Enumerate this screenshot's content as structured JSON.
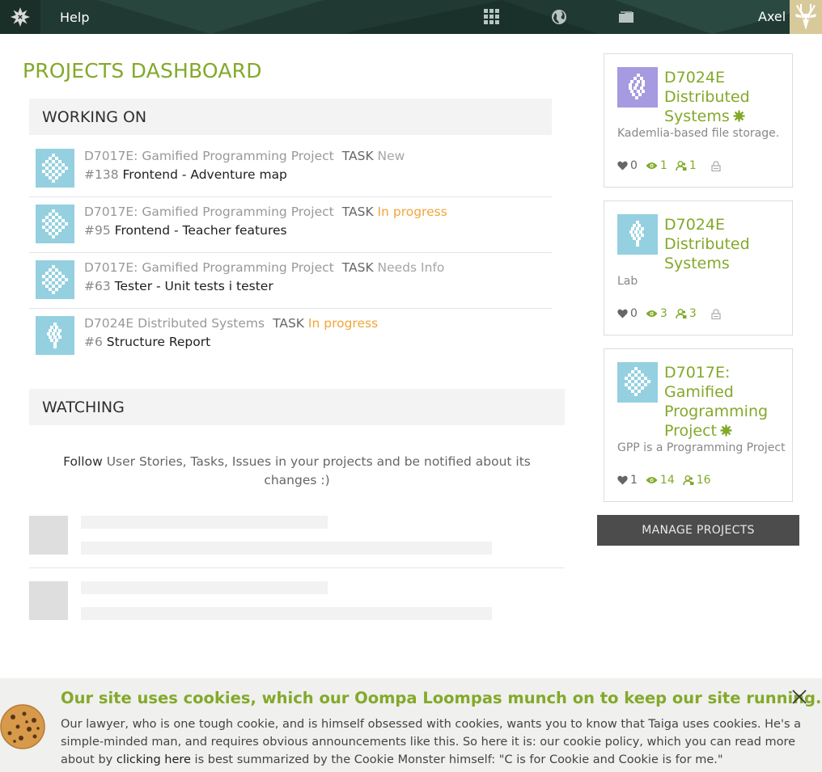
{
  "navbar": {
    "help_label": "Help",
    "user_name": "Axel",
    "icons": [
      "logo-icon",
      "projects-grid-icon",
      "discover-globe-icon",
      "inbox-folder-icon",
      "avatar-deer-icon"
    ]
  },
  "dashboard": {
    "title": "PROJECTS DASHBOARD",
    "working_on_title": "WORKING ON",
    "watching_title": "WATCHING",
    "working_items": [
      {
        "project": "D7017E: Gamified Programming Project",
        "type": "TASK",
        "status": "New",
        "ref": "#138",
        "subject": "Frontend - Adventure map"
      },
      {
        "project": "D7017E: Gamified Programming Project",
        "type": "TASK",
        "status": "In progress",
        "ref": "#95",
        "subject": "Frontend - Teacher features"
      },
      {
        "project": "D7017E: Gamified Programming Project",
        "type": "TASK",
        "status": "Needs Info",
        "ref": "#63",
        "subject": "Tester - Unit tests i tester"
      },
      {
        "project": "D7024E Distributed Systems",
        "type": "TASK",
        "status": "In progress",
        "ref": "#6",
        "subject": "Structure Report"
      }
    ],
    "follow_bold": "Follow",
    "follow_rest": "User Stories, Tasks, Issues in your projects and be notified about its changes :)"
  },
  "projects": [
    {
      "name": "D7024E Distributed Systems",
      "description": "Kademlia-based file storage.",
      "likes": "0",
      "watchers": "1",
      "members": "1",
      "looking_for_people": true,
      "private": true
    },
    {
      "name": "D7024E Distributed Systems",
      "description": "Lab",
      "likes": "0",
      "watchers": "3",
      "members": "3",
      "looking_for_people": false,
      "private": true
    },
    {
      "name": "D7017E: Gamified Programming Project",
      "description": "GPP is a Programming Project",
      "likes": "1",
      "watchers": "14",
      "members": "16",
      "looking_for_people": true,
      "private": false
    }
  ],
  "manage_projects_label": "MANAGE PROJECTS",
  "cookie": {
    "title": "Our site uses cookies, which our Oompa Loompas munch on to keep our site running.",
    "body_before": "Our lawyer, who is one tough cookie, and is himself obsessed with cookies, wants you to know that Taiga uses cookies. He's a simple-minded man, and requires obvious announcements like this. So here it is: our cookie policy, which you can read more about by ",
    "link_label": "clicking here",
    "body_after": " is best summarized by the Cookie Monster himself: \"C is for Cookie and Cookie is for me.\""
  },
  "colors": {
    "navbar": "#203a33",
    "accent_green": "#83a92a",
    "in_progress": "#f2a53a",
    "section_bg": "#f3f3f3",
    "button_dark": "#4c4c4c",
    "cookie_bg": "#f0f0ee"
  }
}
